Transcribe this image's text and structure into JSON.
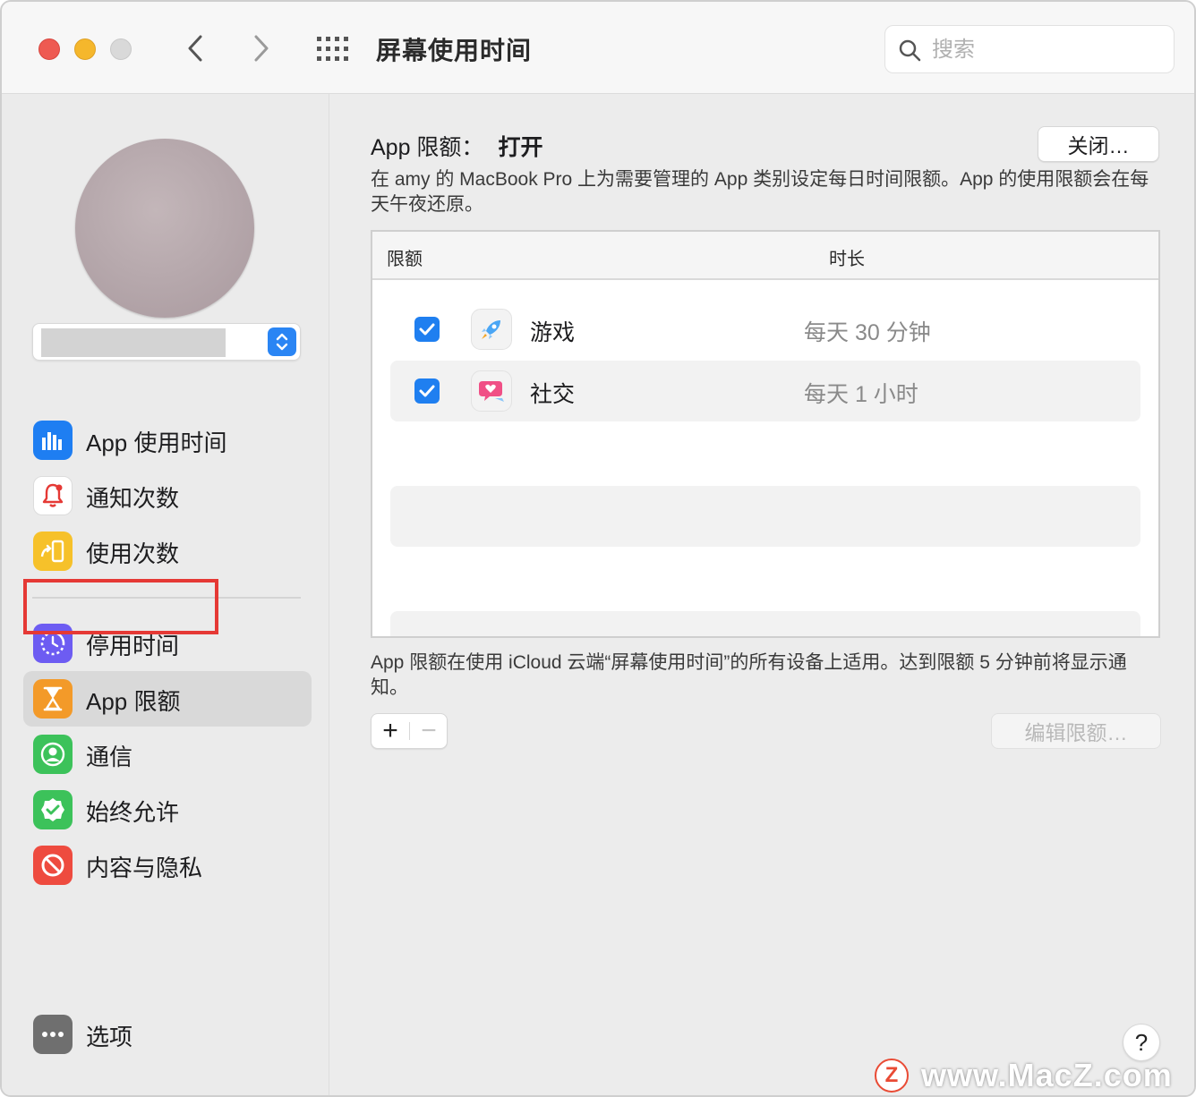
{
  "window": {
    "title": "屏幕使用时间",
    "search_placeholder": "搜索"
  },
  "sidebar": {
    "items_top": [
      {
        "label": "App 使用时间",
        "icon": "bar-chart-icon",
        "color": "#1e7ef2"
      },
      {
        "label": "通知次数",
        "icon": "bell-icon",
        "color": "#ffffff"
      },
      {
        "label": "使用次数",
        "icon": "pickup-icon",
        "color": "#f6c12a"
      }
    ],
    "items_bottom": [
      {
        "label": "停用时间",
        "icon": "downtime-icon",
        "color": "#6d5cf2"
      },
      {
        "label": "App 限额",
        "icon": "hourglass-icon",
        "color": "#f39a29",
        "selected": true
      },
      {
        "label": "通信",
        "icon": "contact-icon",
        "color": "#3cc25a"
      },
      {
        "label": "始终允许",
        "icon": "checkmark-badge-icon",
        "color": "#3cc25a"
      },
      {
        "label": "内容与隐私",
        "icon": "block-icon",
        "color": "#ee4b3f"
      }
    ],
    "options_label": "选项"
  },
  "main": {
    "heading_label": "App 限额：",
    "heading_status": "打开",
    "off_button": "关闭…",
    "description": "在 amy 的 MacBook Pro 上为需要管理的 App 类别设定每日时间限额。App 的使用限额会在每天午夜还原。",
    "table": {
      "headers": {
        "limit": "限额",
        "duration": "时长"
      },
      "rows": [
        {
          "category": "游戏",
          "duration": "每天 30 分钟",
          "checked": true,
          "icon": "rocket-icon"
        },
        {
          "category": "社交",
          "duration": "每天 1 小时",
          "checked": true,
          "icon": "chat-heart-icon"
        }
      ]
    },
    "note": "App 限额在使用 iCloud 云端“屏幕使用时间”的所有设备上适用。达到限额 5 分钟前将显示通知。",
    "add_symbol": "+",
    "remove_symbol": "−",
    "edit_button": "编辑限额…"
  },
  "help": "?",
  "watermark": {
    "logo": "Z",
    "text": "www.MacZ.com"
  }
}
